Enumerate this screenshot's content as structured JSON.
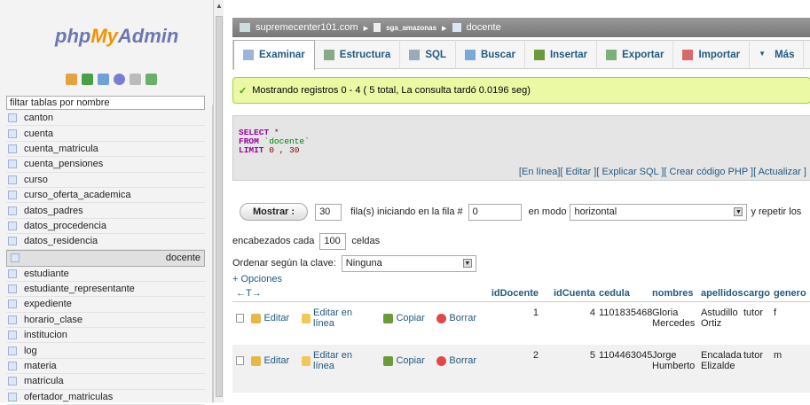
{
  "logo": {
    "php": "php",
    "my": "My",
    "admin": "Admin"
  },
  "sidebar": {
    "filter_placeholder": "filtar tablas por nombre",
    "tables": [
      "canton",
      "cuenta",
      "cuenta_matricula",
      "cuenta_pensiones",
      "curso",
      "curso_oferta_academica",
      "datos_padres",
      "datos_procedencia",
      "datos_residencia",
      "docente",
      "estudiante",
      "estudiante_representante",
      "expediente",
      "horario_clase",
      "institucion",
      "log",
      "materia",
      "matricula",
      "ofertador_matriculas"
    ],
    "selected": "docente"
  },
  "breadcrumb": {
    "server": "supremecenter101.com",
    "db": "sga_amazonas",
    "table": "docente"
  },
  "tabs": [
    "Examinar",
    "Estructura",
    "SQL",
    "Buscar",
    "Insertar",
    "Exportar",
    "Importar",
    "Más"
  ],
  "success_msg": "Mostrando registros 0 - 4 ( 5 total, La consulta tardó 0.0196 seg)",
  "sql": {
    "select": "SELECT",
    "star": " *",
    "from": "FROM",
    "table": " `docente`",
    "limit": "LIMIT",
    "nums": " 0 , 30"
  },
  "sql_links": [
    "[En línea]",
    "[ Editar ]",
    "[ Explicar SQL ]",
    "[ Crear código PHP ]",
    "[ Actualizar ]"
  ],
  "nav": {
    "show_btn": "Mostrar :",
    "rows_value": "30",
    "rows_label": "fila(s) iniciando en la fila #",
    "start_value": "0",
    "mode_label": "en modo",
    "mode_value": "horizontal",
    "repeat_label": "y repetir los",
    "headers_label": "encabezados cada",
    "headers_value": "100",
    "cells_label": "celdas",
    "order_label": "Ordenar según la clave:",
    "order_value": "Ninguna",
    "options": "+ Opciones"
  },
  "grid": {
    "arrows": "←T→",
    "columns": [
      "idDocente",
      "idCuenta",
      "cedula",
      "nombres",
      "apellidos",
      "cargo",
      "genero"
    ],
    "actions": {
      "edit": "Editar",
      "inline": "Editar en línea",
      "copy": "Copiar",
      "delete": "Borrar"
    },
    "rows": [
      {
        "id": "1",
        "cuenta": "4",
        "cedula": "1101835468",
        "nombres": "Gloria Mercedes",
        "apellidos": "Astudillo Ortiz",
        "cargo": "tutor",
        "genero": "f"
      },
      {
        "id": "2",
        "cuenta": "5",
        "cedula": "1104463045",
        "nombres": "Jorge Humberto",
        "apellidos": "Encalada Elizalde",
        "cargo": "tutor",
        "genero": "m"
      }
    ]
  }
}
